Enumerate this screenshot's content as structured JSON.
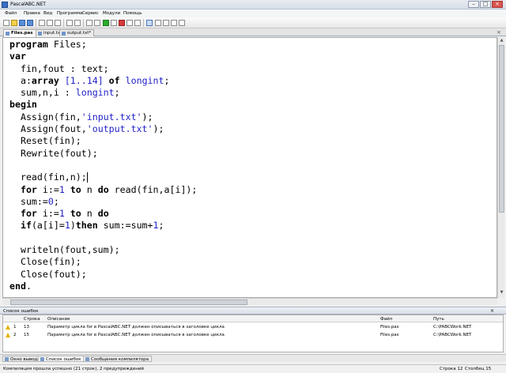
{
  "window": {
    "title": "PascalABC.NET"
  },
  "menu": [
    "Файл",
    "Правка",
    "Вид",
    "Программа",
    "Сервис",
    "Модули",
    "Помощь"
  ],
  "tabs": [
    {
      "label": "Files.pas",
      "active": true
    },
    {
      "label": "input.txt",
      "active": false
    },
    {
      "label": "output.txt*",
      "active": false
    }
  ],
  "code_lines": [
    [
      [
        "kw",
        "program"
      ],
      [
        "plain",
        " Files;"
      ]
    ],
    [
      [
        "kw",
        "var"
      ]
    ],
    [
      [
        "plain",
        "  fin,fout : text;"
      ]
    ],
    [
      [
        "plain",
        "  a:"
      ],
      [
        "kw",
        "array"
      ],
      [
        "plain",
        " "
      ],
      [
        "num",
        "[1..14]"
      ],
      [
        "plain",
        " "
      ],
      [
        "kw",
        "of"
      ],
      [
        "plain",
        " "
      ],
      [
        "typ",
        "longint"
      ],
      [
        "plain",
        ";"
      ]
    ],
    [
      [
        "plain",
        "  sum,n,i : "
      ],
      [
        "typ",
        "longint"
      ],
      [
        "plain",
        ";"
      ]
    ],
    [
      [
        "kw",
        "begin"
      ]
    ],
    [
      [
        "plain",
        "  Assign(fin,"
      ],
      [
        "str",
        "'input.txt'"
      ],
      [
        "plain",
        ");"
      ]
    ],
    [
      [
        "plain",
        "  Assign(fout,"
      ],
      [
        "str",
        "'output.txt'"
      ],
      [
        "plain",
        ");"
      ]
    ],
    [
      [
        "plain",
        "  Reset(fin);"
      ]
    ],
    [
      [
        "plain",
        "  Rewrite(fout);"
      ]
    ],
    [
      [
        "plain",
        ""
      ]
    ],
    [
      [
        "plain",
        "  read(fin,n);"
      ],
      [
        "caret",
        ""
      ]
    ],
    [
      [
        "plain",
        "  "
      ],
      [
        "kw",
        "for"
      ],
      [
        "plain",
        " i:="
      ],
      [
        "num",
        "1"
      ],
      [
        "plain",
        " "
      ],
      [
        "kw",
        "to"
      ],
      [
        "plain",
        " n "
      ],
      [
        "kw",
        "do"
      ],
      [
        "plain",
        " read(fin,a[i]);"
      ]
    ],
    [
      [
        "plain",
        "  sum:="
      ],
      [
        "num",
        "0"
      ],
      [
        "plain",
        ";"
      ]
    ],
    [
      [
        "plain",
        "  "
      ],
      [
        "kw",
        "for"
      ],
      [
        "plain",
        " i:="
      ],
      [
        "num",
        "1"
      ],
      [
        "plain",
        " "
      ],
      [
        "kw",
        "to"
      ],
      [
        "plain",
        " n "
      ],
      [
        "kw",
        "do"
      ]
    ],
    [
      [
        "plain",
        "  "
      ],
      [
        "kw",
        "if"
      ],
      [
        "plain",
        "(a[i]="
      ],
      [
        "num",
        "1"
      ],
      [
        "plain",
        ")"
      ],
      [
        "kw",
        "then"
      ],
      [
        "plain",
        " sum:=sum+"
      ],
      [
        "num",
        "1"
      ],
      [
        "plain",
        ";"
      ]
    ],
    [
      [
        "plain",
        ""
      ]
    ],
    [
      [
        "plain",
        "  writeln(fout,sum);"
      ]
    ],
    [
      [
        "plain",
        "  Close(fin);"
      ]
    ],
    [
      [
        "plain",
        "  Close(fout);"
      ]
    ],
    [
      [
        "kw",
        "end"
      ],
      [
        "plain",
        "."
      ]
    ]
  ],
  "error_panel": {
    "title": "Список ошибок",
    "columns": [
      "Строка",
      "Описание",
      "Файл",
      "Путь"
    ],
    "rows": [
      {
        "num": "1",
        "line": "13",
        "desc": "Параметр цикла for в PascalABC.NET должен описываться в заголовке цикла",
        "file": "Files.pas",
        "path": "C:\\PABCWork.NET"
      },
      {
        "num": "2",
        "line": "15",
        "desc": "Параметр цикла for в PascalABC.NET должен описываться в заголовке цикла",
        "file": "Files.pas",
        "path": "C:\\PABCWork.NET"
      }
    ]
  },
  "bottom_tabs": [
    {
      "label": "Окно вывода",
      "active": false
    },
    {
      "label": "Список ошибок",
      "active": true
    },
    {
      "label": "Сообщения компилятора",
      "active": false
    }
  ],
  "status": {
    "message": "Компиляция прошла успешно (21 строк), 2 предупреждений",
    "row": "Строка  12",
    "col": "Столбец  15"
  }
}
